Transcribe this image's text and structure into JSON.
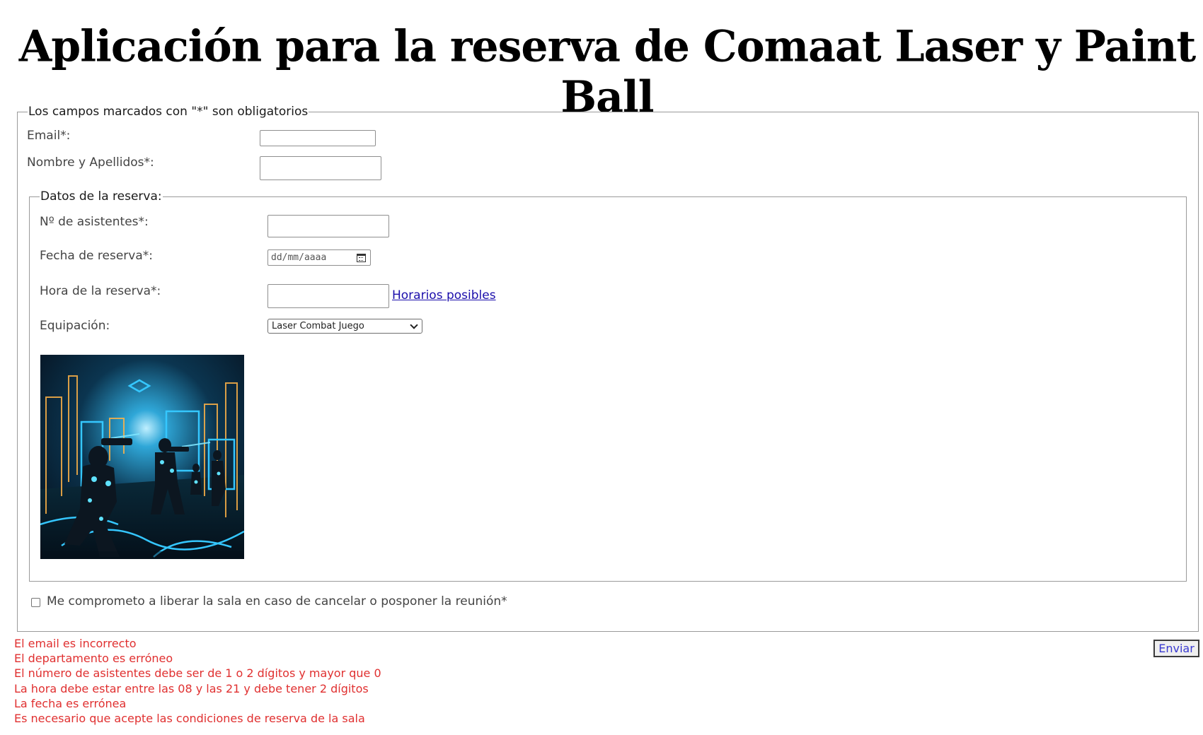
{
  "page": {
    "title": "Aplicación para la reserva de Comaat Laser y Paint Ball"
  },
  "form": {
    "legend": "Los campos marcados con \"*\" son obligatorios",
    "email": {
      "label": "Email*:",
      "value": ""
    },
    "name": {
      "label": "Nombre y Apellidos*:",
      "value": ""
    },
    "reservation": {
      "legend": "Datos de la reserva:",
      "attendees": {
        "label": "Nº de asistentes*:",
        "value": ""
      },
      "date": {
        "label": "Fecha de reserva*:",
        "placeholder": "dd/mm/aaaa"
      },
      "time": {
        "label": "Hora de la reserva*:",
        "value": "",
        "link": "Horarios posibles"
      },
      "equipment": {
        "label": "Equipación:",
        "selected": "Laser Combat Juego"
      }
    },
    "agree": {
      "label": "Me comprometo a liberar la sala en caso de cancelar o posponer la reunión*",
      "checked": false
    },
    "submit": "Enviar"
  },
  "errors": [
    "El email es incorrecto",
    "El departamento es erróneo",
    "El número de asistentes debe ser de 1 o 2 dígitos y mayor que 0",
    "La hora debe estar entre las 08 y las 21 y debe tener 2 dígitos",
    "La fecha es errónea",
    "Es necesario que acepte las condiciones de reserva de la sala"
  ],
  "colors": {
    "error": "#e03030",
    "link": "#1a0dab",
    "border": "#9a9a9a",
    "neon": "#35c7ff"
  },
  "icons": {
    "date": "calendar-icon",
    "select": "chevron-down-icon"
  }
}
